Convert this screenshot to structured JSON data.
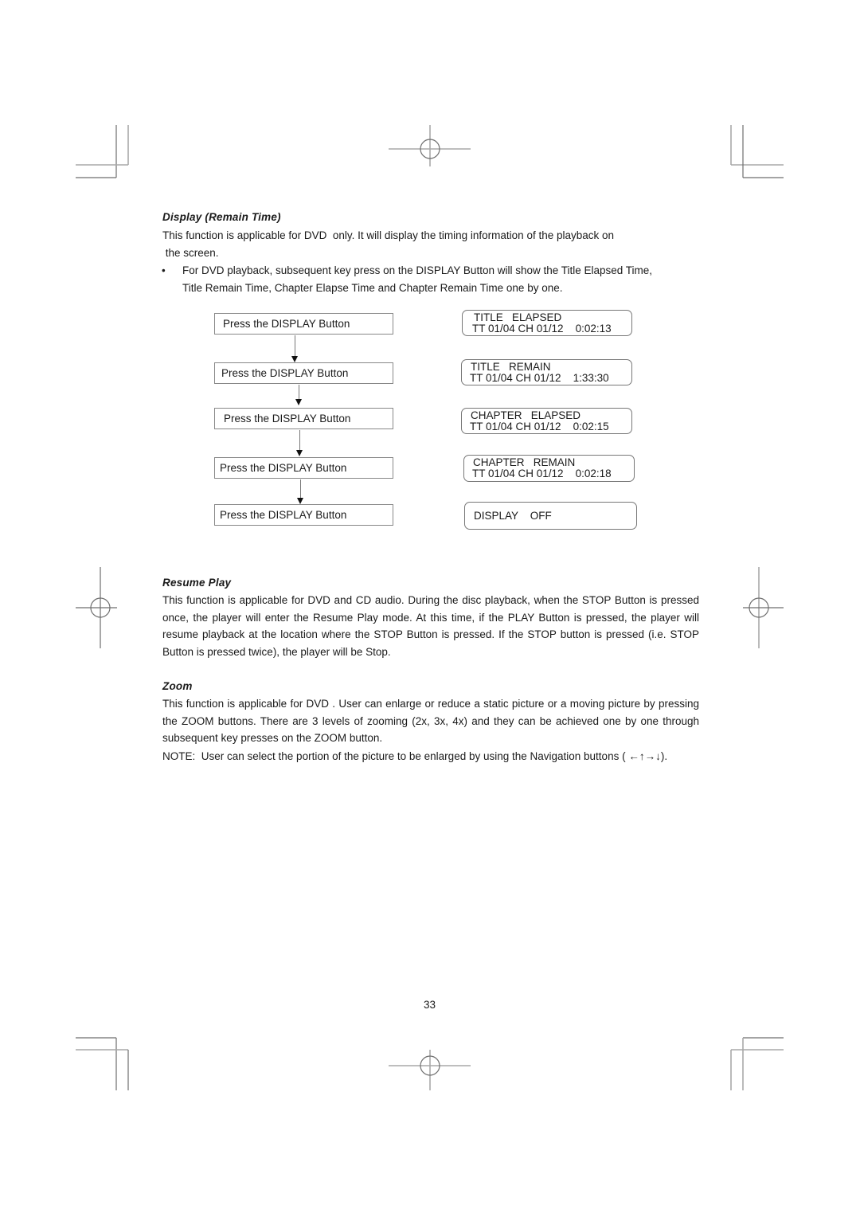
{
  "sections": {
    "display": {
      "heading": "Display (Remain Time)",
      "intro_line1": "This function is applicable for DVD  only. It will display the timing information of the playback on",
      "intro_line2": " the screen.",
      "bullet_symbol": "•",
      "bullet_line1": "For DVD playback, subsequent key press on the DISPLAY Button will show the Title Elapsed Time,",
      "bullet_line2": "Title Remain Time, Chapter Elapse Time and Chapter Remain Time one by one."
    },
    "resume": {
      "heading": "Resume Play",
      "body": "This function is applicable for DVD and CD audio. During the disc playback, when the STOP Button is pressed once, the player will enter the Resume Play mode. At this time, if the PLAY Button is pressed, the player will resume playback at the location where the STOP Button is pressed. If the STOP button is pressed (i.e. STOP Button is pressed twice), the player will be Stop."
    },
    "zoom": {
      "heading": "Zoom",
      "body": "This function is applicable for DVD . User can enlarge or reduce a static picture or a moving picture by pressing the ZOOM buttons. There are 3 levels of zooming (2x, 3x, 4x) and they can be achieved one by one through subsequent key presses on the ZOOM button.",
      "note": "NOTE:  User can select the portion of the picture to be enlarged by using the Navigation buttons ( ←↑→↓)."
    }
  },
  "flow": {
    "steps": [
      {
        "action": "Press the DISPLAY Button",
        "osd_line1": "TITLE   ELAPSED",
        "osd_line2": "TT 01/04 CH 01/12    0:02:13"
      },
      {
        "action": "Press the DISPLAY Button",
        "osd_line1": "TITLE   REMAIN",
        "osd_line2": "TT 01/04 CH 01/12    1:33:30"
      },
      {
        "action": "Press the DISPLAY Button",
        "osd_line1": "CHAPTER   ELAPSED",
        "osd_line2": "TT 01/04 CH 01/12    0:02:15"
      },
      {
        "action": "Press the DISPLAY Button",
        "osd_line1": "CHAPTER   REMAIN",
        "osd_line2": "TT 01/04 CH 01/12    0:02:18"
      },
      {
        "action": "Press the DISPLAY Button",
        "osd_line1": "DISPLAY    OFF",
        "osd_line2": ""
      }
    ]
  },
  "page_number": "33"
}
